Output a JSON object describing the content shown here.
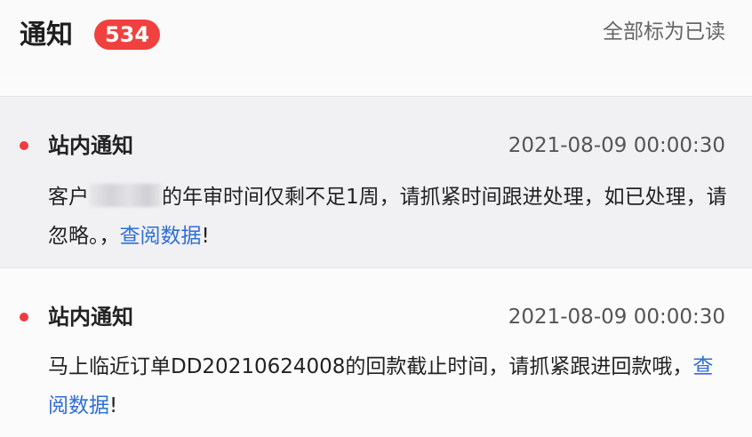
{
  "header": {
    "title": "通知",
    "unread_count": "534",
    "mark_all_read": "全部标为已读"
  },
  "notifications": [
    {
      "title": "站内通知",
      "time": "2021-08-09 00:00:30",
      "text_before": "客户",
      "text_after": "的年审时间仅剩不足1周，请抓紧时间跟进处理，如已处理，请忽略。，",
      "link": "查阅数据",
      "suffix": "!"
    },
    {
      "title": "站内通知",
      "time": "2021-08-09 00:00:30",
      "text": "马上临近订单DD20210624008的回款截止时间，请抓紧跟进回款哦，",
      "link": "查阅数据",
      "suffix": "!"
    }
  ],
  "colors": {
    "badge": "#f0413f",
    "unread_dot": "#ee3b3b",
    "link": "#2f6fd6",
    "highlight_row": "#f1f1f4"
  }
}
